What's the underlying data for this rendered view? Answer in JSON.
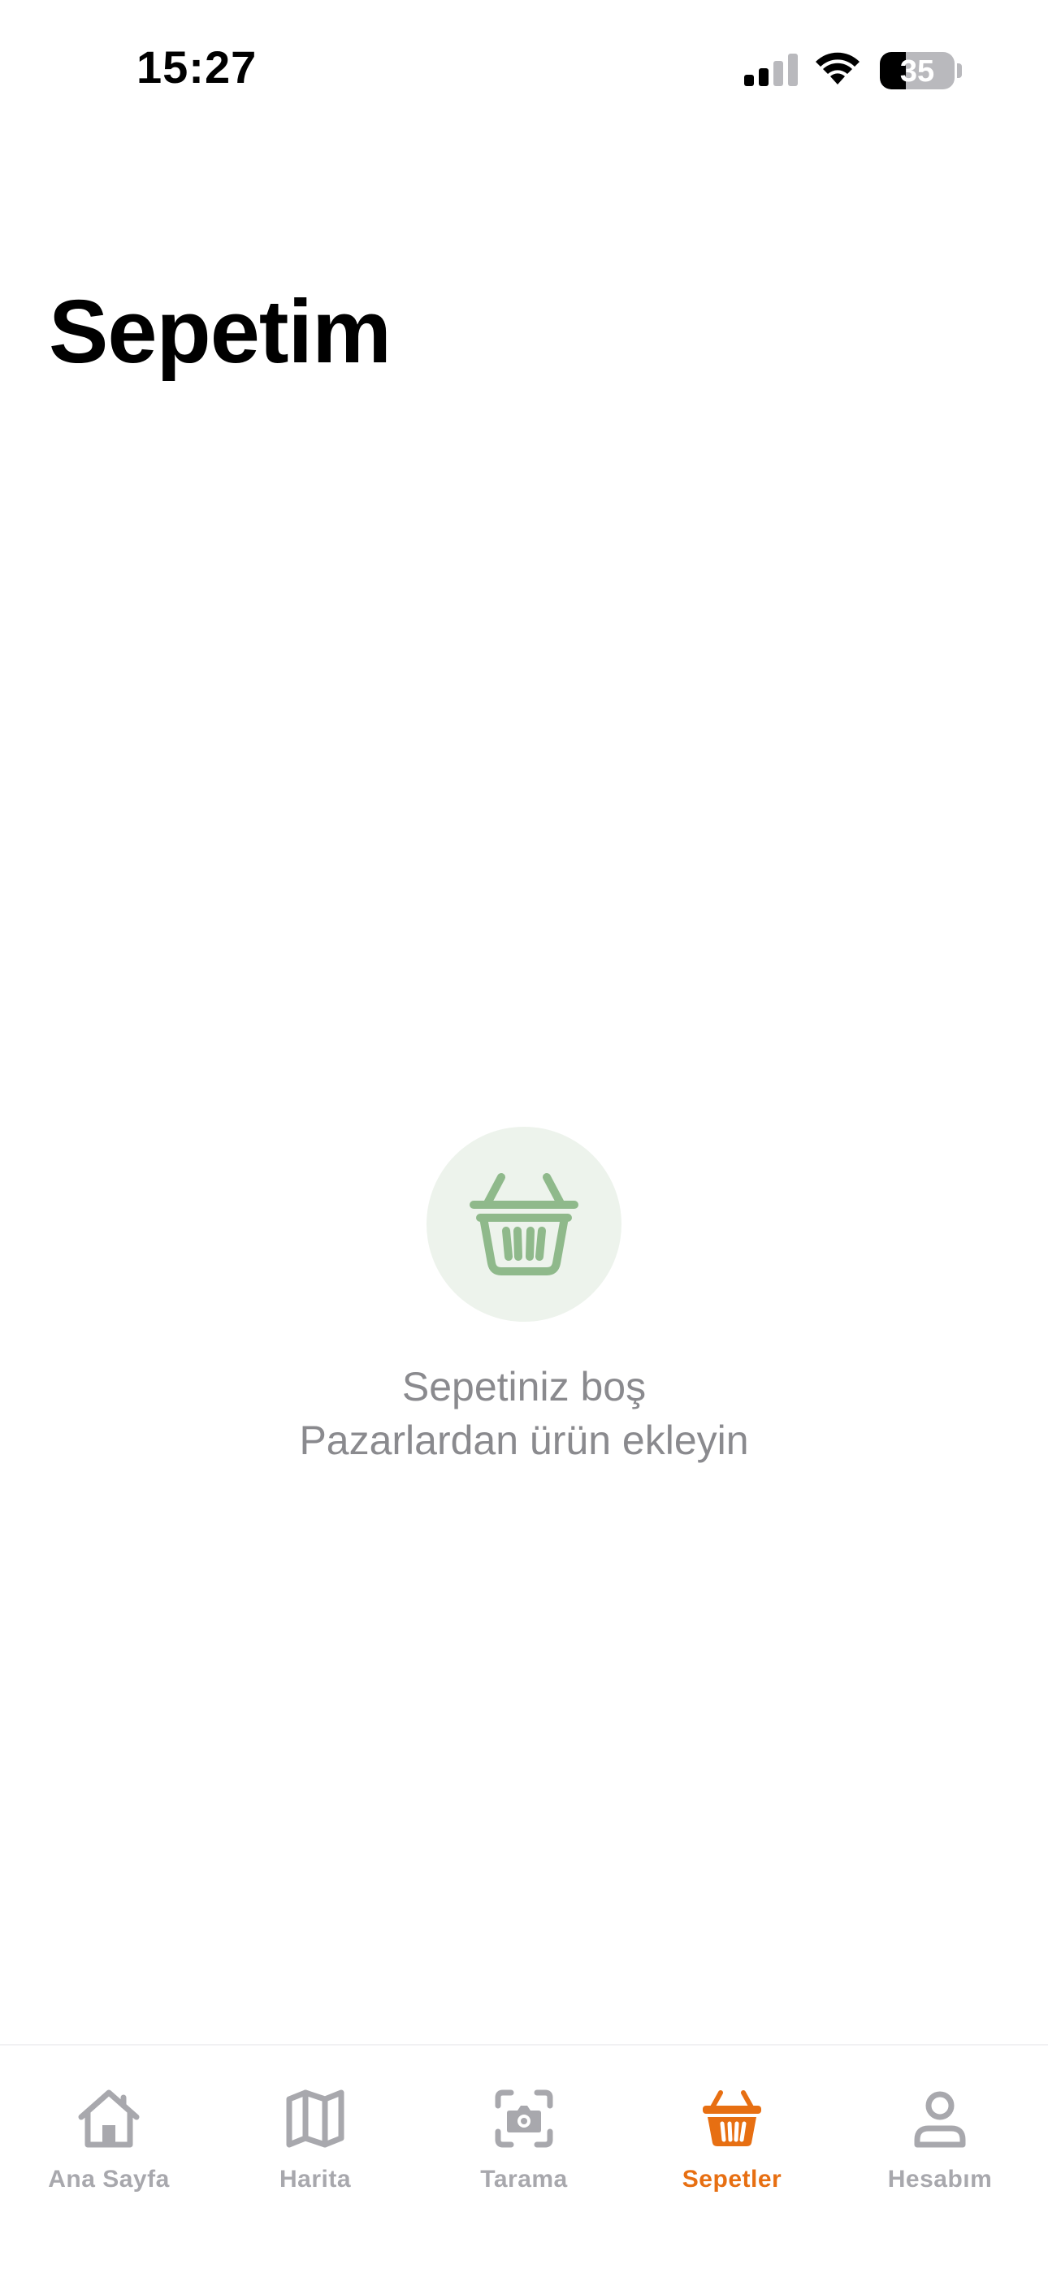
{
  "status_bar": {
    "time": "15:27",
    "battery_level": "35",
    "battery_fraction": 0.35,
    "signal_icon": "cellular-signal-icon",
    "wifi_icon": "wifi-icon"
  },
  "page": {
    "title": "Sepetim"
  },
  "empty_state": {
    "icon": "basket-icon",
    "title": "Sepetiniz boş",
    "subtitle": "Pazarlardan ürün ekleyin",
    "icon_color": "#8fb98b",
    "circle_color": "#edf3ec"
  },
  "tab_bar": {
    "accent_color": "#e76f12",
    "inactive_color": "#a8a8ad",
    "tabs": [
      {
        "label": "Ana Sayfa",
        "icon": "home-icon",
        "active": false
      },
      {
        "label": "Harita",
        "icon": "map-icon",
        "active": false
      },
      {
        "label": "Tarama",
        "icon": "camera-scan-icon",
        "active": false
      },
      {
        "label": "Sepetler",
        "icon": "basket-icon",
        "active": true
      },
      {
        "label": "Hesabım",
        "icon": "person-icon",
        "active": false
      }
    ]
  }
}
